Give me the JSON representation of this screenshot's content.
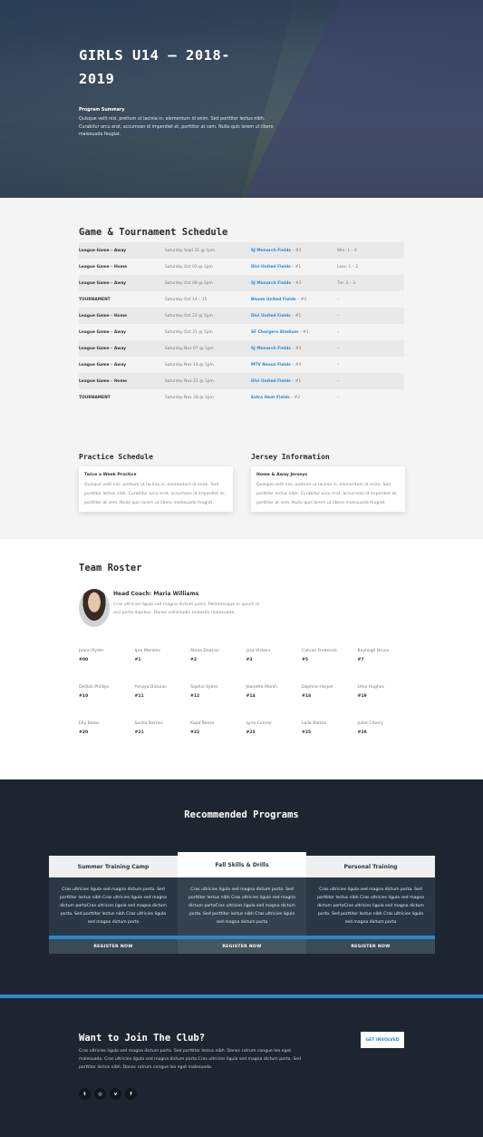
{
  "hero": {
    "title": "GIRLS U14 – 2018-2019",
    "summary_title": "Program Summary",
    "summary": "Quisque velit nisi, pretium ut lacinia in, elementum id enim. Sed porttitor lectus nibh. Curabitur arcu erat, accumsan id imperdiet et, porttitor at sem. Nulla quis lorem ut libero malesuada feugiat."
  },
  "schedule": {
    "title": "Game & Tournament Schedule",
    "rows": [
      {
        "type": "League Game – Away",
        "date": "Saturday Sept 31 @ 1pm",
        "venue": "SJ Monarch Fields",
        "field": " – #3",
        "result": "Win: 1 – 0"
      },
      {
        "type": "League Game – Home",
        "date": "Saturday Oct 02 @ 1pm",
        "venue": "Divi United Fields",
        "field": " – #1",
        "result": "Loss: 1 – 2"
      },
      {
        "type": "League Game – Away",
        "date": "Saturday Oct 08 @ 1pm",
        "venue": "SJ Monarch Fields",
        "field": " – #2",
        "result": "Tie: 3 – 3"
      },
      {
        "type": "TOURNAMENT",
        "date": "Saturday Oct 14 – 15",
        "venue": "Bloom United Fields",
        "field": " – #4",
        "result": "–"
      },
      {
        "type": "League Game – Home",
        "date": "Saturday Oct 22 @ 1pm",
        "venue": "Divi United Fields",
        "field": " – #1",
        "result": "–"
      },
      {
        "type": "League Game – Away",
        "date": "Saturday Oct 31 @ 1pm",
        "venue": "SF Chargers Stadium",
        "field": " – #1",
        "result": "–"
      },
      {
        "type": "League Game – Away",
        "date": "Saturday Nov 07 @ 1pm",
        "venue": "SJ Monarch Fields",
        "field": " – #3",
        "result": "–"
      },
      {
        "type": "League Game – Away",
        "date": "Saturday Nov 14 @ 1pm",
        "venue": "MTV Nexus Fields",
        "field": " – #4",
        "result": "–"
      },
      {
        "type": "League Game – Home",
        "date": "Saturday Nov 21 @ 1pm",
        "venue": "Divi United Fields",
        "field": " – #1",
        "result": "–"
      },
      {
        "type": "TOURNAMENT",
        "date": "Saturday Nov 28 @ 1pm",
        "venue": "Extra Heat Fields",
        "field": " – #2",
        "result": "–"
      }
    ]
  },
  "practice": {
    "title": "Practice Schedule",
    "card_title": "Twice a Week Practice",
    "card_body": "Quisque velit nisi, pretium ut lacinia in, elementum id enim. Sed porttitor lectus nibh. Curabitur arcu erat, accumsan id imperdiet et, porttitor at sem. Nulla quis lorem ut libero malesuada feugiat."
  },
  "jersey": {
    "title": "Jersey Information",
    "card_title": "Home & Away Jerseys",
    "card_body": "Quisque velit nisi, pretium ut lacinia in, elementum id enim. Sed porttitor lectus nibh. Curabitur arcu erat, accumsan id imperdiet et, porttitor at sem. Nulla quis lorem ut libero malesuada feugiat."
  },
  "roster": {
    "title": "Team Roster",
    "coach_name": "Head Coach: Maria Williams",
    "coach_desc": "Cras ultricies ligula sed magna dictum porta. Pellentesque in ipsum id orci porta dapibus. Donec sollicitudin molestie malesuada.",
    "players": [
      {
        "name": "Joann Ryder",
        "num": "#00"
      },
      {
        "name": "Ipra Morales",
        "num": "#1"
      },
      {
        "name": "Alena Deacan",
        "num": "#2"
      },
      {
        "name": "Lisa Vickers",
        "num": "#3"
      },
      {
        "name": "Catvan Frederick",
        "num": "#5"
      },
      {
        "name": "Bayleigh Bruce",
        "num": "#7"
      },
      {
        "name": "Delilah Phillips",
        "num": "#10"
      },
      {
        "name": "Amaya Dickson",
        "num": "#11"
      },
      {
        "name": "Sophia Sykes",
        "num": "#12"
      },
      {
        "name": "Jeanette Marsh",
        "num": "#14"
      },
      {
        "name": "Daphne Harper",
        "num": "#18"
      },
      {
        "name": "Uma Hughes",
        "num": "#19"
      },
      {
        "name": "Elly Bates",
        "num": "#20"
      },
      {
        "name": "Sasha Barnes",
        "num": "#21"
      },
      {
        "name": "Kajal Reese",
        "num": "#22"
      },
      {
        "name": "Lyna Connor",
        "num": "#23"
      },
      {
        "name": "Laila Barton",
        "num": "#25"
      },
      {
        "name": "Juliet Cherry",
        "num": "#28"
      }
    ]
  },
  "programs": {
    "title": "Recommended Programs",
    "items": [
      {
        "name": "Summer Training Camp",
        "desc": "Cras ultricies ligula sed magna dictum porta. Sed porttitor lectus nibh Cras ultricies ligula sed magna dictum portaCras ultricies ligula sed magna dictum porta. Sed porttitor lectus nibh Cras ultricies ligula sed magna dictum porta",
        "button": "REGISTER NOW"
      },
      {
        "name": "Fall Skills & Drills",
        "desc": "Cras ultricies ligula sed magna dictum porta. Sed porttitor lectus nibh Cras ultricies ligula sed magna dictum portaCras ultricies ligula sed magna dictum porta. Sed porttitor lectus nibh Cras ultricies ligula sed magna dictum porta",
        "button": "REGISTER NOW"
      },
      {
        "name": "Personal Training",
        "desc": "Cras ultricies ligula sed magna dictum porta. Sed porttitor lectus nibh Cras ultricies ligula sed magna dictum portaCras ultricies ligula sed magna dictum porta. Sed porttitor lectus nibh Cras ultricies ligula sed magna dictum porta",
        "button": "REGISTER NOW"
      }
    ]
  },
  "join": {
    "title": "Want to Join The Club?",
    "desc": "Cras ultricies ligula sed magna dictum porta. Sed porttitor lectus nibh. Donec rutrum congue leo eget malesuada. Cras ultricies ligula sed magna dictum porta.Cras ultricies ligula sed magna dictum porta. Sed porttitor lectus nibh. Donec rutrum congue leo eget malesuada.",
    "button": "GET INVOLVED",
    "social": [
      {
        "icon": "twitter-icon",
        "glyph": "t"
      },
      {
        "icon": "instagram-icon",
        "glyph": "◎"
      },
      {
        "icon": "vimeo-icon",
        "glyph": "v"
      },
      {
        "icon": "facebook-icon",
        "glyph": "f"
      }
    ]
  },
  "colors": {
    "accent": "#2b87d1",
    "dark_bg": "#1d2630",
    "light_bg": "#f4f4f4"
  }
}
